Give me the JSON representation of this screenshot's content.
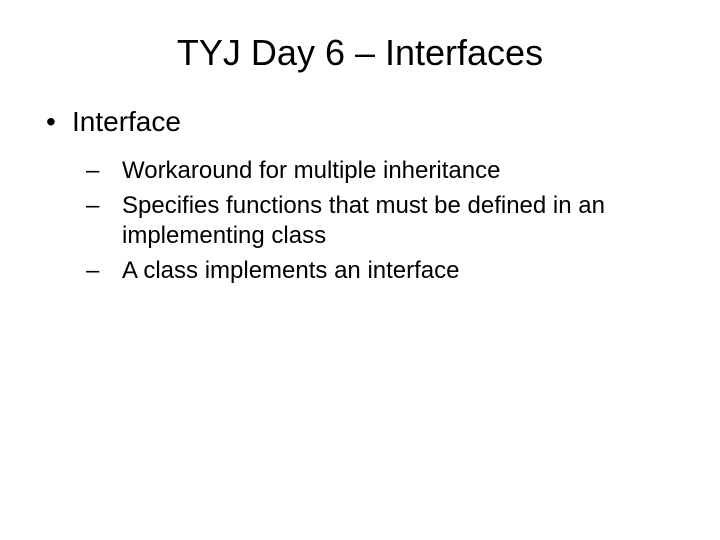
{
  "title": "TYJ Day 6 – Interfaces",
  "bullets": [
    {
      "label": "Interface",
      "subs": [
        "Workaround for multiple inheritance",
        "Specifies functions that must be defined in an implementing class",
        "A class implements an interface"
      ]
    }
  ]
}
